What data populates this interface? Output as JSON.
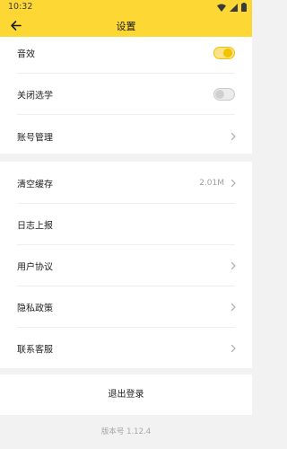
{
  "status_bar": {
    "time": "10:32",
    "icons": [
      "wifi-icon",
      "cellular-icon",
      "battery-icon"
    ]
  },
  "app_bar": {
    "back_icon": "arrow-left-icon",
    "title": "设置"
  },
  "group1": {
    "sound": {
      "label": "音效",
      "enabled": true
    },
    "close_select": {
      "label": "关闭选学",
      "enabled": false
    },
    "account": {
      "label": "账号管理"
    }
  },
  "group2": {
    "clear_cache": {
      "label": "清空缓存",
      "value": "2.01M"
    },
    "log_report": {
      "label": "日志上报"
    },
    "user_agreement": {
      "label": "用户协议"
    },
    "privacy_policy": {
      "label": "隐私政策"
    },
    "contact_support": {
      "label": "联系客服"
    }
  },
  "logout_label": "退出登录",
  "version_text": "版本号 1.12.4",
  "colors": {
    "accent": "#fdd835",
    "toggle_on": "#f2c200",
    "background": "#f2f2f2"
  }
}
